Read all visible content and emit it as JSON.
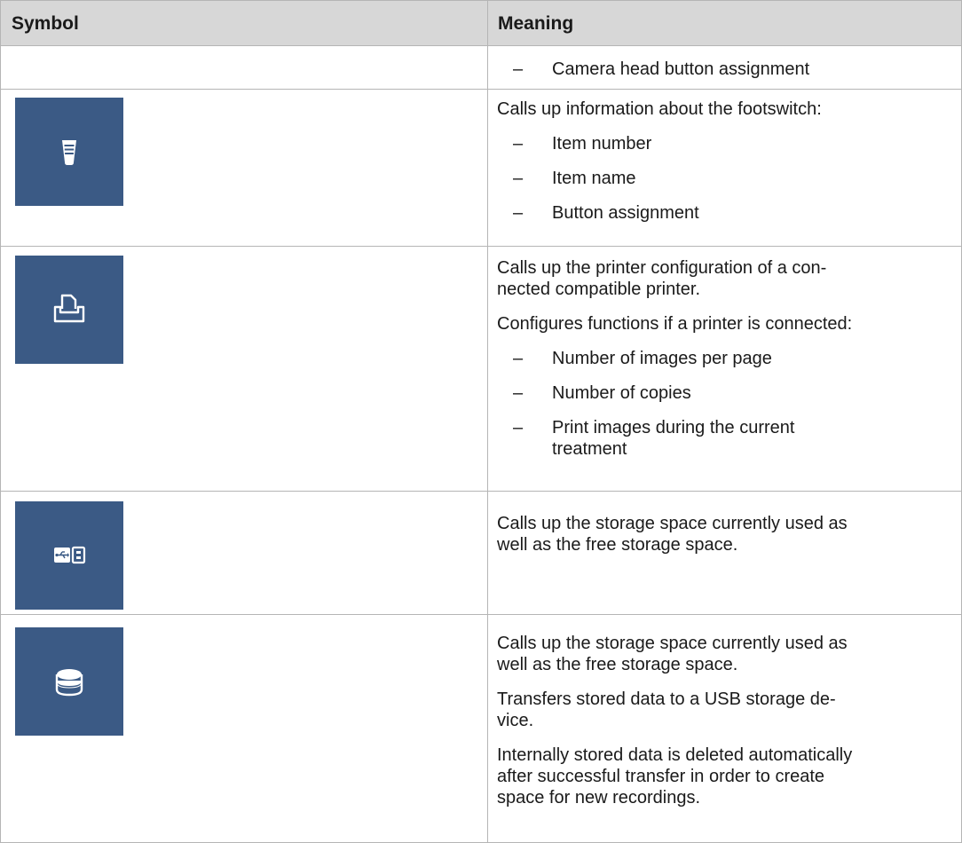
{
  "header": {
    "symbol_label": "Symbol",
    "meaning_label": "Meaning"
  },
  "rows": [
    {
      "icon": null,
      "paragraphs": [],
      "bullets": [
        "Camera head button assignment"
      ]
    },
    {
      "icon": "footswitch-info-icon",
      "paragraphs": [
        "Calls up information about the footswitch:"
      ],
      "bullets": [
        "Item number",
        "Item name",
        "Button assignment"
      ]
    },
    {
      "icon": "printer-icon",
      "paragraphs": [
        "Calls up the printer configuration of a con-\nnected compatible printer.",
        "Configures functions if a printer is connected:"
      ],
      "bullets": [
        "Number of images per page",
        "Number of copies",
        "Print images during the current\ntreatment"
      ]
    },
    {
      "icon": "usb-storage-icon",
      "paragraphs": [
        "Calls up the storage space currently used as\nwell as the free storage space."
      ],
      "bullets": []
    },
    {
      "icon": "internal-storage-icon",
      "paragraphs": [
        "Calls up the storage space currently used as\nwell as the free storage space.",
        "Transfers stored data to a USB storage de-\nvice.",
        "Internally stored data is deleted automatically\nafter successful transfer in order to create\nspace for new recordings."
      ],
      "bullets": []
    }
  ],
  "bullet_dash": "–",
  "colors": {
    "header_bg": "#d7d7d7",
    "tile_bg": "#3b5a85",
    "border": "#b5b5b5"
  }
}
